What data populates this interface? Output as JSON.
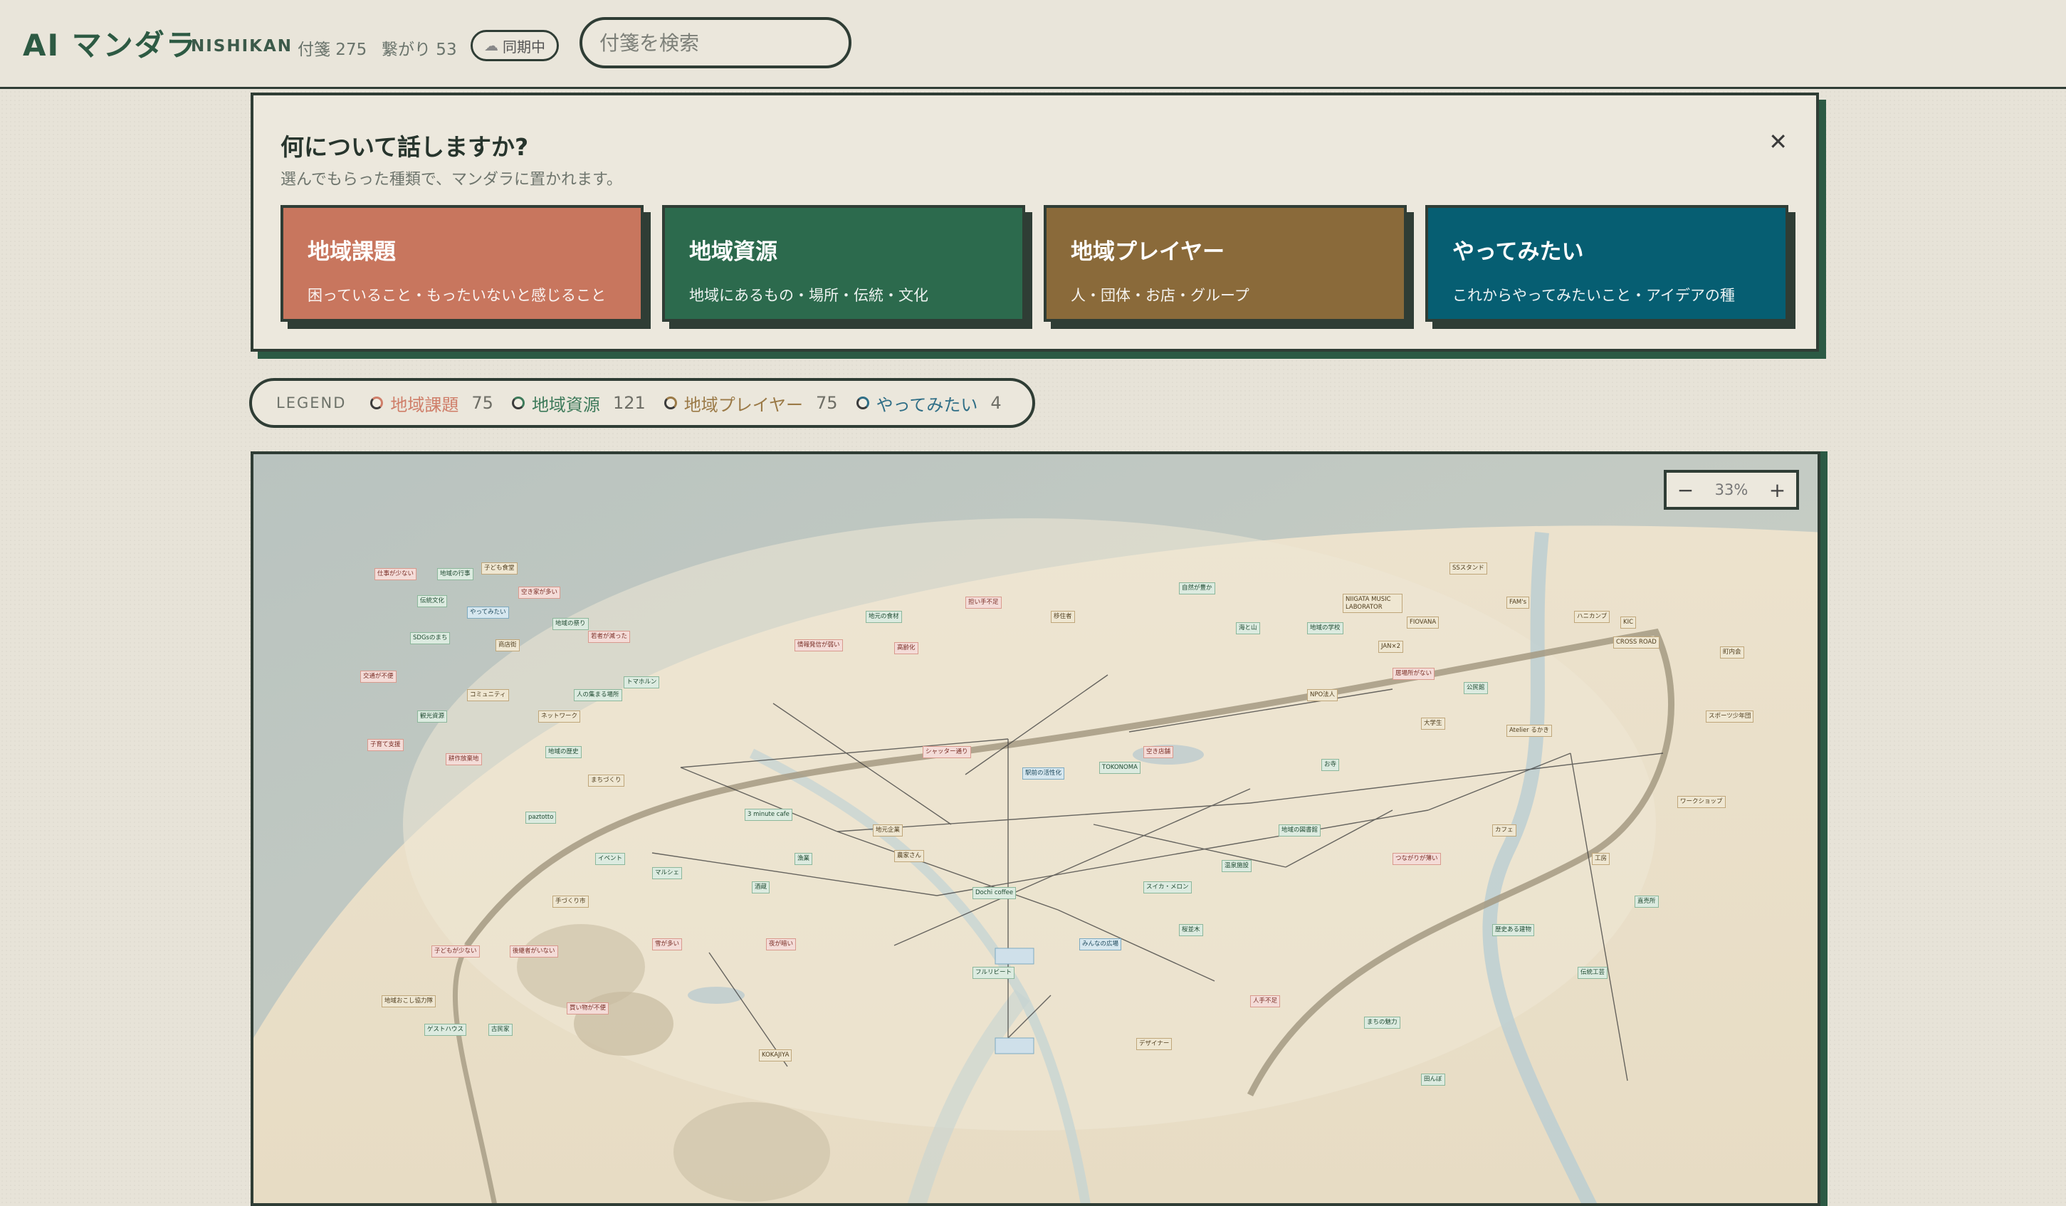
{
  "header": {
    "app_title": "AI マンダラ",
    "org": "NISHIKAN",
    "notes_label": "付箋 275",
    "links_label": "繋がり 53",
    "sync_label": "同期中",
    "search_placeholder": "付箋を検索"
  },
  "dialog": {
    "title": "何について話しますか?",
    "subtitle": "選んでもらった種類で、マンダラに置かれます。",
    "categories": [
      {
        "name": "地域課題",
        "desc": "困っていること・もったいないと感じること",
        "color": "#c8765e"
      },
      {
        "name": "地域資源",
        "desc": "地域にあるもの・場所・伝統・文化",
        "color": "#2c6a4d"
      },
      {
        "name": "地域プレイヤー",
        "desc": "人・団体・お店・グループ",
        "color": "#8a6a3a"
      },
      {
        "name": "やってみたい",
        "desc": "これからやってみたいこと・アイデアの種",
        "color": "#065e72"
      }
    ]
  },
  "legend": {
    "title": "LEGEND",
    "items": [
      {
        "name": "地域課題",
        "count": "75",
        "color": "#cf7e69"
      },
      {
        "name": "地域資源",
        "count": "121",
        "color": "#3d7a5a"
      },
      {
        "name": "地域プレイヤー",
        "count": "75",
        "color": "#9b7a47"
      },
      {
        "name": "やってみたい",
        "count": "4",
        "color": "#2f6e86"
      }
    ]
  },
  "zoom": {
    "minus": "−",
    "value": "33%",
    "plus": "+"
  },
  "notes": [
    {
      "t": "仕事が少ない",
      "k": "kadai"
    },
    {
      "t": "地域の行事",
      "k": "shigen"
    },
    {
      "t": "子ども食堂",
      "k": "player"
    },
    {
      "t": "空き家が多い",
      "k": "kadai"
    },
    {
      "t": "伝統文化",
      "k": "shigen"
    },
    {
      "t": "やってみたい",
      "k": "yatte"
    },
    {
      "t": "地域の祭り",
      "k": "shigen"
    },
    {
      "t": "若者が減った",
      "k": "kadai"
    },
    {
      "t": "商店街",
      "k": "player"
    },
    {
      "t": "SDGsのまち",
      "k": "shigen"
    },
    {
      "t": "交通が不便",
      "k": "kadai"
    },
    {
      "t": "トマホルン",
      "k": "shigen"
    },
    {
      "t": "人の集まる場所",
      "k": "shigen"
    },
    {
      "t": "ネットワーク",
      "k": "player"
    },
    {
      "t": "コミュニティ",
      "k": "player"
    },
    {
      "t": "観光資源",
      "k": "shigen"
    },
    {
      "t": "子育て支援",
      "k": "kadai"
    },
    {
      "t": "耕作放棄地",
      "k": "kadai"
    },
    {
      "t": "地域の歴史",
      "k": "shigen"
    },
    {
      "t": "まちづくり",
      "k": "player"
    },
    {
      "t": "NIIGATA MUSIC LABORATOR",
      "k": "player"
    },
    {
      "t": "FAM's",
      "k": "player"
    },
    {
      "t": "SSスタンド",
      "k": "player"
    },
    {
      "t": "FIOVANA",
      "k": "player"
    },
    {
      "t": "JAN×2",
      "k": "player"
    },
    {
      "t": "CROSS ROAD",
      "k": "player"
    },
    {
      "t": "KIC",
      "k": "player"
    },
    {
      "t": "ハニカンブ",
      "k": "player"
    },
    {
      "t": "TOKONOMA",
      "k": "shigen"
    },
    {
      "t": "Dochi coffee",
      "k": "shigen"
    },
    {
      "t": "3 minute cafe",
      "k": "shigen"
    },
    {
      "t": "paztotto",
      "k": "shigen"
    },
    {
      "t": "フルリビート",
      "k": "shigen"
    },
    {
      "t": "KOKAJIYA",
      "k": "player"
    },
    {
      "t": "Atelier るかき",
      "k": "player"
    },
    {
      "t": "スイカ・メロン",
      "k": "shigen"
    },
    {
      "t": "温泉施設",
      "k": "shigen"
    },
    {
      "t": "地元の食材",
      "k": "shigen"
    },
    {
      "t": "担い手不足",
      "k": "kadai"
    },
    {
      "t": "情報発信が弱い",
      "k": "kadai"
    },
    {
      "t": "高齢化",
      "k": "kadai"
    },
    {
      "t": "移住者",
      "k": "player"
    },
    {
      "t": "自然が豊か",
      "k": "shigen"
    },
    {
      "t": "海と山",
      "k": "shigen"
    },
    {
      "t": "地域の学校",
      "k": "shigen"
    },
    {
      "t": "居場所がない",
      "k": "kadai"
    },
    {
      "t": "公民館",
      "k": "shigen"
    },
    {
      "t": "NPO法人",
      "k": "player"
    },
    {
      "t": "大学生",
      "k": "player"
    },
    {
      "t": "お寺",
      "k": "shigen"
    },
    {
      "t": "空き店舗",
      "k": "kadai"
    },
    {
      "t": "駅前の活性化",
      "k": "yatte"
    },
    {
      "t": "シャッター通り",
      "k": "kadai"
    },
    {
      "t": "地元企業",
      "k": "player"
    },
    {
      "t": "農家さん",
      "k": "player"
    },
    {
      "t": "漁業",
      "k": "shigen"
    },
    {
      "t": "酒蔵",
      "k": "shigen"
    },
    {
      "t": "マルシェ",
      "k": "shigen"
    },
    {
      "t": "イベント",
      "k": "shigen"
    },
    {
      "t": "手づくり市",
      "k": "player"
    },
    {
      "t": "後継者がいない",
      "k": "kadai"
    },
    {
      "t": "子どもが少ない",
      "k": "kadai"
    },
    {
      "t": "地域おこし協力隊",
      "k": "player"
    },
    {
      "t": "ゲストハウス",
      "k": "shigen"
    },
    {
      "t": "古民家",
      "k": "shigen"
    },
    {
      "t": "買い物が不便",
      "k": "kadai"
    },
    {
      "t": "雪が多い",
      "k": "kadai"
    },
    {
      "t": "夜が暗い",
      "k": "kadai"
    },
    {
      "t": "みんなの広場",
      "k": "yatte"
    },
    {
      "t": "桜並木",
      "k": "shigen"
    },
    {
      "t": "地域の図書館",
      "k": "shigen"
    },
    {
      "t": "つながりが薄い",
      "k": "kadai"
    },
    {
      "t": "カフェ",
      "k": "player"
    },
    {
      "t": "工房",
      "k": "player"
    },
    {
      "t": "直売所",
      "k": "shigen"
    },
    {
      "t": "ワークショップ",
      "k": "player"
    },
    {
      "t": "スポーツ少年団",
      "k": "player"
    },
    {
      "t": "町内会",
      "k": "player"
    },
    {
      "t": "人手不足",
      "k": "kadai"
    },
    {
      "t": "まちの魅力",
      "k": "shigen"
    },
    {
      "t": "田んぼ",
      "k": "shigen"
    },
    {
      "t": "歴史ある建物",
      "k": "shigen"
    },
    {
      "t": "伝統工芸",
      "k": "shigen"
    },
    {
      "t": "デザイナー",
      "k": "player"
    }
  ]
}
